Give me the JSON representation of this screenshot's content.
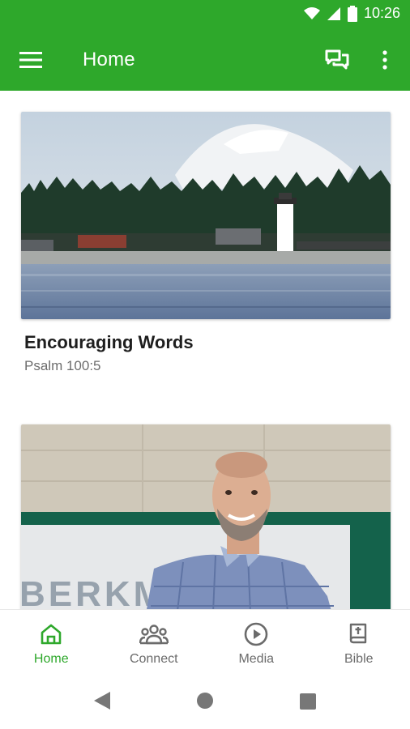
{
  "status_bar": {
    "time": "10:26"
  },
  "app_bar": {
    "title": "Home"
  },
  "cards": [
    {
      "title": "Encouraging Words",
      "subtitle": "Psalm 100:5"
    },
    {
      "title": "",
      "subtitle": ""
    }
  ],
  "bottom_nav": {
    "items": [
      {
        "label": "Home",
        "icon": "home-icon",
        "active": true
      },
      {
        "label": "Connect",
        "icon": "people-icon",
        "active": false
      },
      {
        "label": "Media",
        "icon": "play-circle-icon",
        "active": false
      },
      {
        "label": "Bible",
        "icon": "bible-icon",
        "active": false
      }
    ]
  },
  "photo_text": {
    "sign_text": "BERKMA"
  },
  "colors": {
    "accent": "#2ea82b",
    "nav_inactive": "#6b6b6b",
    "text_dark": "#1e1e1e",
    "text_muted": "#6d6d6d"
  }
}
